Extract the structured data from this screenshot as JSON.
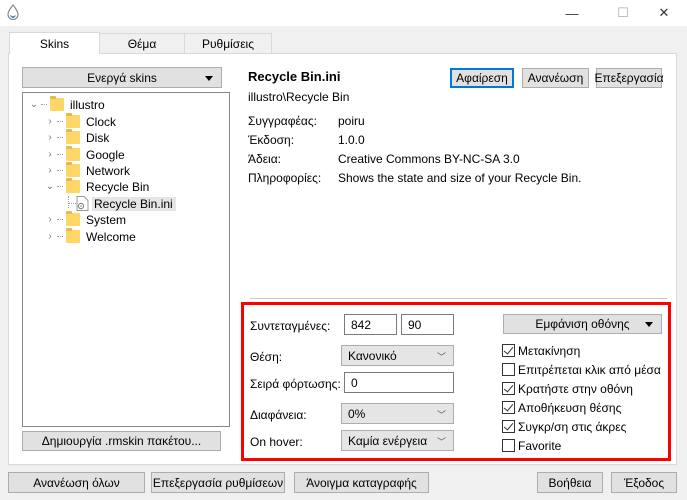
{
  "window": {
    "icon": "droplet-icon",
    "controls": {
      "minimize": "—",
      "maximize": "☐",
      "close": "✕"
    }
  },
  "tabs": [
    {
      "label": "Skins",
      "active": true
    },
    {
      "label": "Θέμα",
      "active": false
    },
    {
      "label": "Ρυθμίσεις",
      "active": false
    }
  ],
  "left": {
    "active_skins_dropdown": "Ενεργά skins",
    "tree": [
      {
        "label": "illustro",
        "level": 0,
        "expanded": true,
        "type": "folder"
      },
      {
        "label": "Clock",
        "level": 1,
        "expanded": false,
        "type": "folder"
      },
      {
        "label": "Disk",
        "level": 1,
        "expanded": false,
        "type": "folder"
      },
      {
        "label": "Google",
        "level": 1,
        "expanded": false,
        "type": "folder"
      },
      {
        "label": "Network",
        "level": 1,
        "expanded": false,
        "type": "folder"
      },
      {
        "label": "Recycle Bin",
        "level": 1,
        "expanded": true,
        "type": "folder"
      },
      {
        "label": "Recycle Bin.ini",
        "level": 2,
        "type": "file",
        "selected": true
      },
      {
        "label": "System",
        "level": 1,
        "expanded": false,
        "type": "folder"
      },
      {
        "label": "Welcome",
        "level": 1,
        "expanded": false,
        "type": "folder"
      }
    ],
    "create_package_button": "Δημιουργία .rmskin πακέτου..."
  },
  "skin": {
    "title": "Recycle Bin.ini",
    "path": "illustro\\Recycle Bin",
    "buttons": {
      "remove": "Αφαίρεση",
      "refresh": "Ανανέωση",
      "edit": "Επεξεργασία"
    },
    "info": [
      {
        "label": "Συγγραφέας:",
        "value": "poiru"
      },
      {
        "label": "Έκδοση:",
        "value": "1.0.0"
      },
      {
        "label": "Άδεια:",
        "value": "Creative Commons BY-NC-SA 3.0"
      },
      {
        "label": "Πληροφορίες:",
        "value": "Shows the state and size of your Recycle Bin."
      }
    ]
  },
  "settings": {
    "coordinates_label": "Συντεταγμένες:",
    "coord_x": "842",
    "coord_y": "90",
    "position_label": "Θέση:",
    "position_value": "Κανονικό",
    "load_order_label": "Σειρά φόρτωσης:",
    "load_order_value": "0",
    "transparency_label": "Διαφάνεια:",
    "transparency_value": "0%",
    "on_hover_label": "On hover:",
    "on_hover_value": "Καμία ενέργεια",
    "display_monitor_dropdown": "Εμφάνιση οθόνης",
    "checkboxes": [
      {
        "label": "Μετακίνηση",
        "checked": true
      },
      {
        "label": "Επιτρέπεται κλικ από μέσα",
        "checked": false
      },
      {
        "label": "Κρατήστε στην οθόνη",
        "checked": true
      },
      {
        "label": "Αποθήκευση θέσης",
        "checked": true
      },
      {
        "label": "Συγκρ/ση στις άκρες",
        "checked": true
      },
      {
        "label": "Favorite",
        "checked": false
      }
    ]
  },
  "footer": {
    "refresh_all": "Ανανέωση όλων",
    "edit_settings": "Επεξεργασία ρυθμίσεων",
    "open_log": "Άνοιγμα καταγραφής",
    "help": "Βοήθεια",
    "exit": "Έξοδος"
  },
  "colors": {
    "highlight_box": "#ff0000",
    "default_button_border": "#0078d7",
    "folder": "#fcd768"
  }
}
